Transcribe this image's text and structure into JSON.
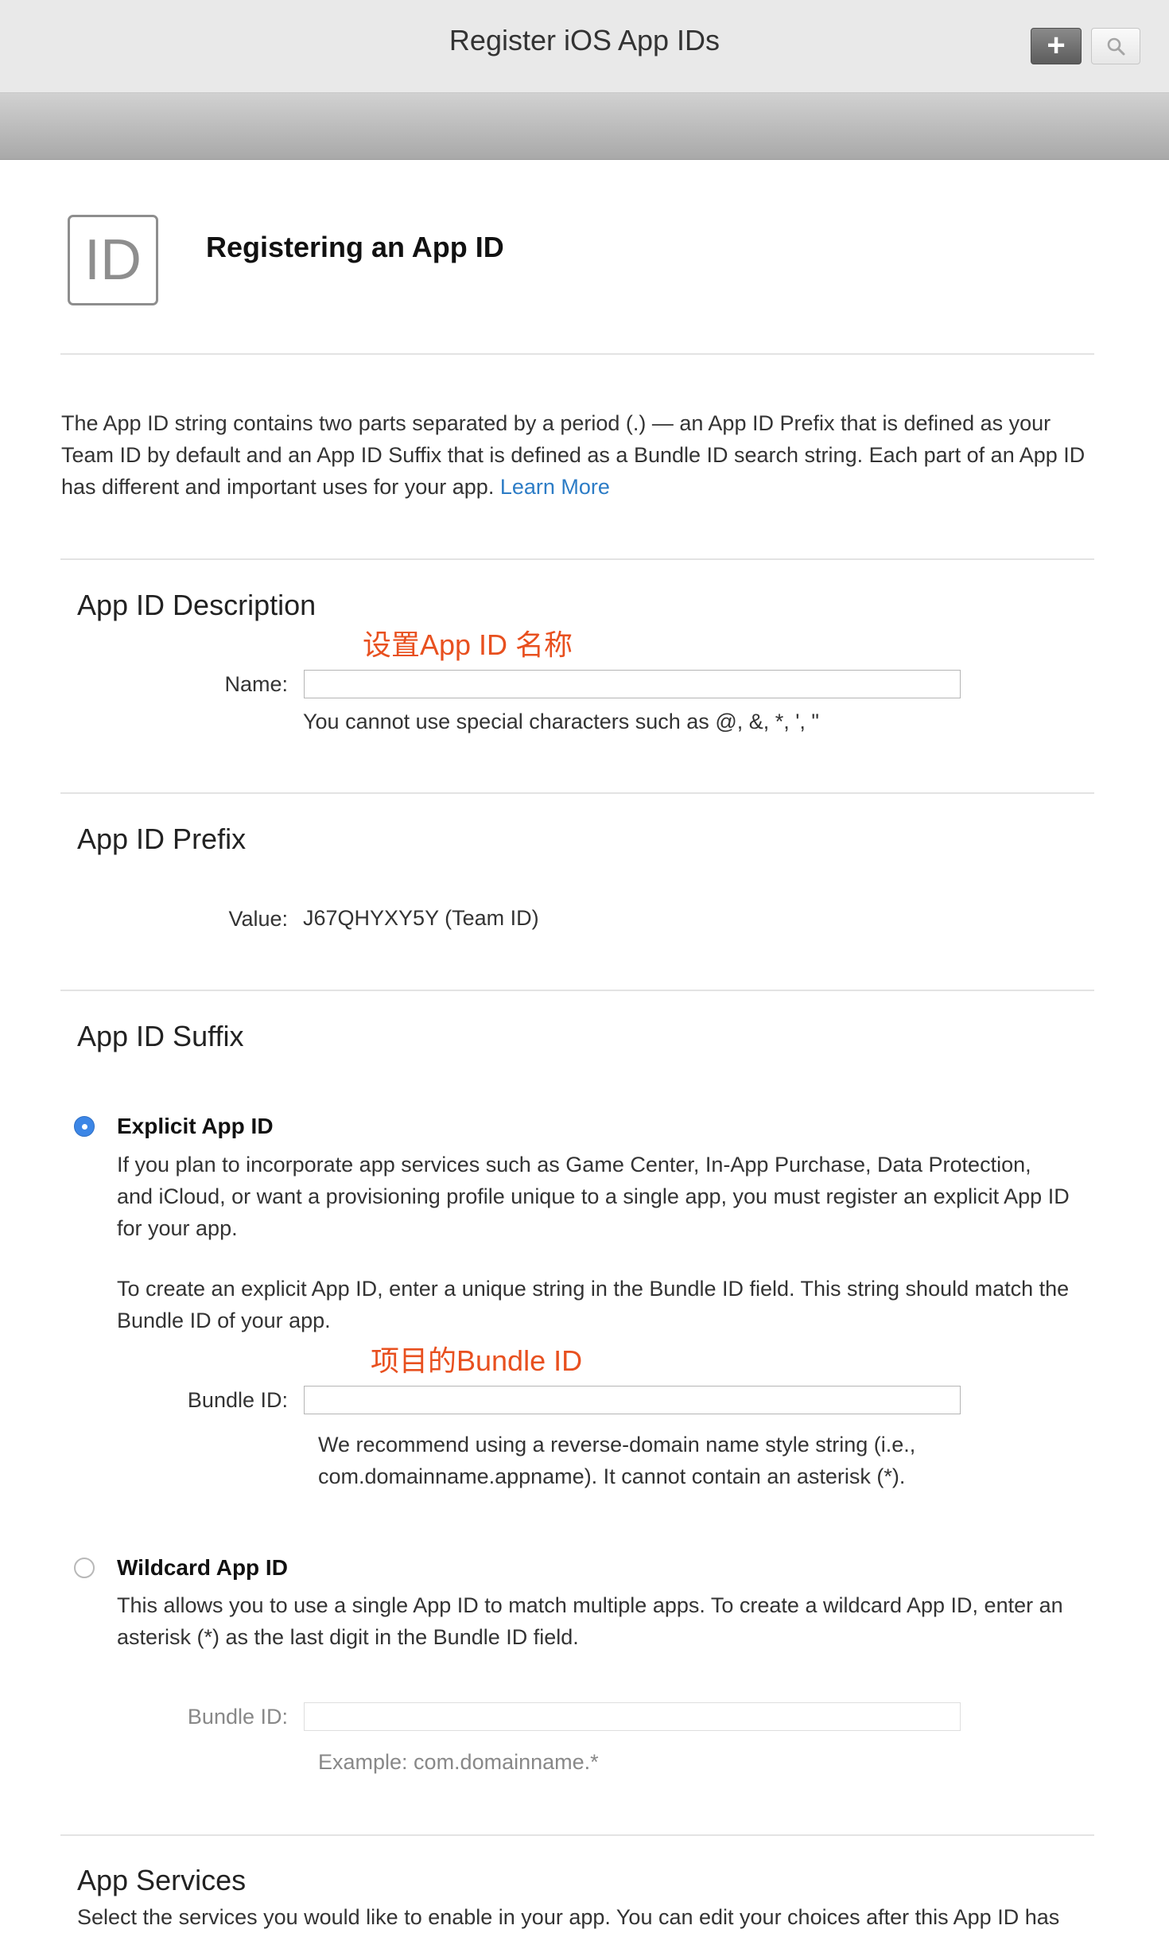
{
  "header": {
    "title": "Register iOS App IDs"
  },
  "toolbar": {
    "add_symbol": "+",
    "search_icon": "search-icon",
    "add_icon": "plus-icon"
  },
  "hero": {
    "icon_text": "ID",
    "title": "Registering an App ID"
  },
  "intro": {
    "text": "The App ID string contains two parts separated by a period (.) — an App ID Prefix that is defined as your Team ID by default and an App ID Suffix that is defined as a Bundle ID search string. Each part of an App ID has different and important uses for your app. ",
    "link": "Learn More"
  },
  "description": {
    "title": "App ID Description",
    "annotation": "设置App ID 名称",
    "name_label": "Name:",
    "name_value": "",
    "name_hint": "You cannot use special characters such as @, &, *, ', \""
  },
  "prefix": {
    "title": "App ID Prefix",
    "value_label": "Value:",
    "value": "J67QHYXY5Y (Team ID)"
  },
  "suffix": {
    "title": "App ID Suffix",
    "explicit": {
      "title": "Explicit App ID",
      "selected": true,
      "para1": "If you plan to incorporate app services such as Game Center, In-App Purchase, Data Protection, and iCloud, or want a provisioning profile unique to a single app, you must register an explicit App ID for your app.",
      "para2": "To create an explicit App ID, enter a unique string in the Bundle ID field. This string should match the Bundle ID of your app.",
      "annotation": "项目的Bundle ID",
      "bundle_label": "Bundle ID:",
      "bundle_value": "",
      "hint": "We recommend using a reverse-domain name style string (i.e., com.domainname.appname). It cannot contain an asterisk (*)."
    },
    "wildcard": {
      "title": "Wildcard App ID",
      "selected": false,
      "para": "This allows you to use a single App ID to match multiple apps. To create a wildcard App ID, enter an asterisk (*) as the last digit in the Bundle ID field.",
      "bundle_label": "Bundle ID:",
      "bundle_value": "",
      "example": "Example: com.domainname.*"
    }
  },
  "services": {
    "title": "App Services",
    "partial_text": "Select the services you would like to enable in your app. You can edit your choices after this App ID has"
  },
  "colors": {
    "accent": "#3c86e6",
    "link": "#2c7cc6",
    "annotation": "#e8501f"
  }
}
